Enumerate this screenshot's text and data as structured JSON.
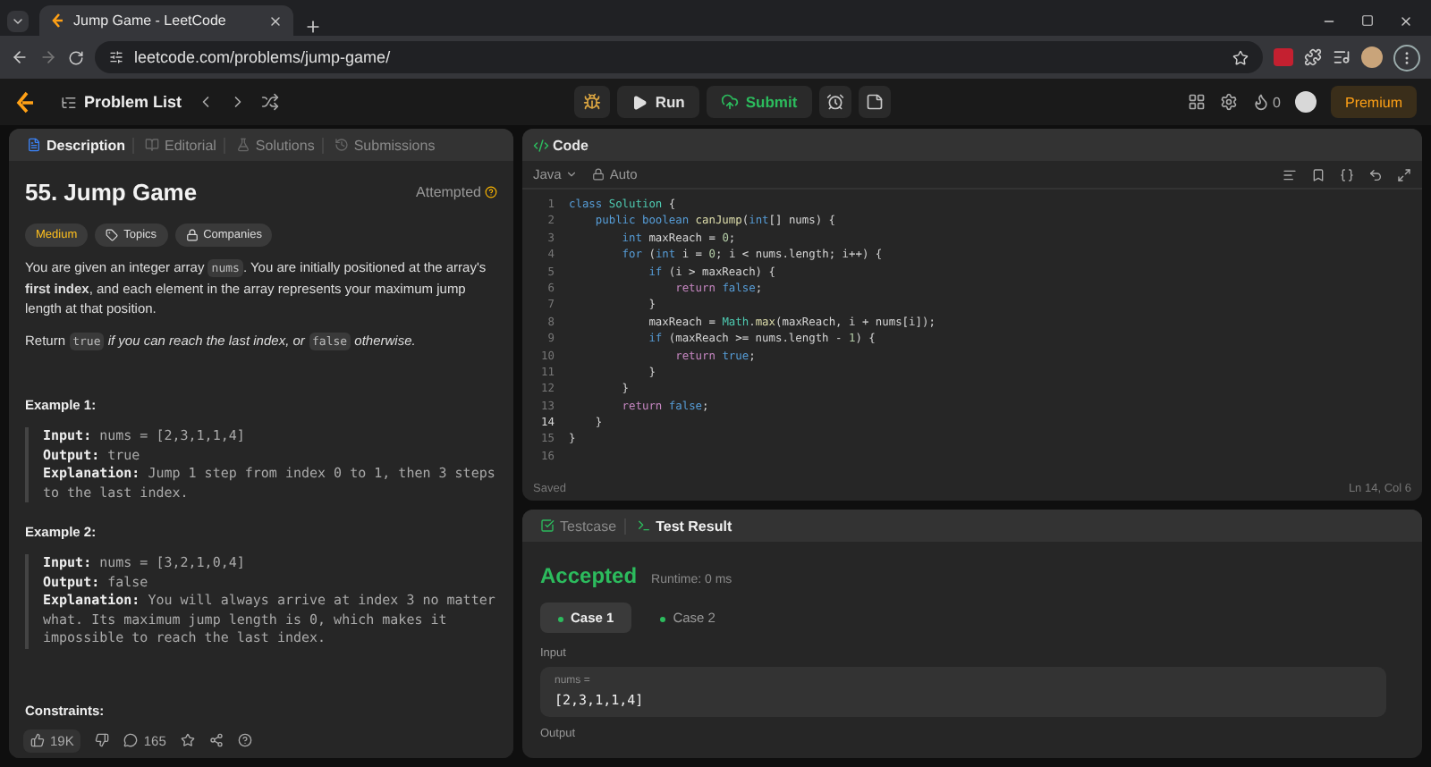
{
  "browser": {
    "tab_title": "Jump Game - LeetCode",
    "url": "leetcode.com/problems/jump-game/"
  },
  "nav": {
    "problem_list": "Problem List",
    "run": "Run",
    "submit": "Submit",
    "streak": "0",
    "premium": "Premium"
  },
  "description": {
    "tabs": [
      {
        "label": "Description",
        "selected": true
      },
      {
        "label": "Editorial",
        "selected": false
      },
      {
        "label": "Solutions",
        "selected": false
      },
      {
        "label": "Submissions",
        "selected": false
      }
    ],
    "title": "55. Jump Game",
    "status": "Attempted",
    "difficulty": "Medium",
    "chips": [
      "Topics",
      "Companies"
    ],
    "paragraphs": [
      [
        {
          "kind": "text",
          "text": "You are given an integer array "
        },
        {
          "kind": "code",
          "text": "nums"
        },
        {
          "kind": "text",
          "text": ". You are initially positioned at the array's "
        },
        {
          "kind": "bold",
          "text": "first index"
        },
        {
          "kind": "text",
          "text": ", and each element in the array represents your maximum jump length at that position."
        }
      ],
      [
        {
          "kind": "text",
          "text": "Return "
        },
        {
          "kind": "code",
          "text": "true"
        },
        {
          "kind": "italic",
          "text": " if you can reach the last index, or "
        },
        {
          "kind": "code",
          "text": "false"
        },
        {
          "kind": "italic",
          "text": " otherwise."
        }
      ]
    ],
    "examples": [
      {
        "title": "Example 1:",
        "lines": [
          {
            "label": "Input:",
            "value": "nums = [2,3,1,1,4]"
          },
          {
            "label": "Output:",
            "value": "true"
          },
          {
            "label": "Explanation:",
            "value": "Jump 1 step from index 0 to 1, then 3 steps to the last index."
          }
        ]
      },
      {
        "title": "Example 2:",
        "lines": [
          {
            "label": "Input:",
            "value": "nums = [3,2,1,0,4]"
          },
          {
            "label": "Output:",
            "value": "false"
          },
          {
            "label": "Explanation:",
            "value": "You will always arrive at index 3 no matter what. Its maximum jump length is 0, which makes it impossible to reach the last index."
          }
        ]
      }
    ],
    "constraints_title": "Constraints:",
    "likes": "19K",
    "comments": "165"
  },
  "code": {
    "title": "Code",
    "language": "Java",
    "mode": "Auto",
    "lines": [
      {
        "number": "1",
        "tokens": [
          {
            "kind": "kw",
            "text": "class "
          },
          {
            "kind": "cls",
            "text": "Solution"
          },
          {
            "kind": "plain",
            "text": " {"
          }
        ]
      },
      {
        "number": "2",
        "tokens": [
          {
            "kind": "kw",
            "text": "    public boolean "
          },
          {
            "kind": "fn",
            "text": "canJump"
          },
          {
            "kind": "plain",
            "text": "("
          },
          {
            "kind": "type",
            "text": "int"
          },
          {
            "kind": "plain",
            "text": "[] nums) {"
          }
        ]
      },
      {
        "number": "3",
        "tokens": [
          {
            "kind": "type",
            "text": "        int"
          },
          {
            "kind": "plain",
            "text": " maxReach = "
          },
          {
            "kind": "num",
            "text": "0"
          },
          {
            "kind": "plain",
            "text": ";"
          }
        ]
      },
      {
        "number": "4",
        "tokens": [
          {
            "kind": "kw",
            "text": "        for"
          },
          {
            "kind": "plain",
            "text": " ("
          },
          {
            "kind": "type",
            "text": "int"
          },
          {
            "kind": "plain",
            "text": " i = "
          },
          {
            "kind": "num",
            "text": "0"
          },
          {
            "kind": "plain",
            "text": "; i < nums.length; i++) {"
          }
        ]
      },
      {
        "number": "5",
        "tokens": [
          {
            "kind": "kw",
            "text": "            if"
          },
          {
            "kind": "plain",
            "text": " (i > maxReach) {"
          }
        ]
      },
      {
        "number": "6",
        "tokens": [
          {
            "kind": "ctl",
            "text": "                return "
          },
          {
            "kind": "lit",
            "text": "false"
          },
          {
            "kind": "plain",
            "text": ";"
          }
        ]
      },
      {
        "number": "7",
        "tokens": [
          {
            "kind": "plain",
            "text": "            }"
          }
        ]
      },
      {
        "number": "8",
        "tokens": [
          {
            "kind": "plain",
            "text": "            maxReach = "
          },
          {
            "kind": "cls",
            "text": "Math"
          },
          {
            "kind": "plain",
            "text": "."
          },
          {
            "kind": "fn",
            "text": "max"
          },
          {
            "kind": "plain",
            "text": "(maxReach, i + nums[i]);"
          }
        ]
      },
      {
        "number": "9",
        "tokens": [
          {
            "kind": "kw",
            "text": "            if"
          },
          {
            "kind": "plain",
            "text": " (maxReach >= nums.length - "
          },
          {
            "kind": "num",
            "text": "1"
          },
          {
            "kind": "plain",
            "text": ") {"
          }
        ]
      },
      {
        "number": "10",
        "tokens": [
          {
            "kind": "ctl",
            "text": "                return "
          },
          {
            "kind": "lit",
            "text": "true"
          },
          {
            "kind": "plain",
            "text": ";"
          }
        ]
      },
      {
        "number": "11",
        "tokens": [
          {
            "kind": "plain",
            "text": "            }"
          }
        ]
      },
      {
        "number": "12",
        "tokens": [
          {
            "kind": "plain",
            "text": "        }"
          }
        ]
      },
      {
        "number": "13",
        "tokens": [
          {
            "kind": "ctl",
            "text": "        return "
          },
          {
            "kind": "lit",
            "text": "false"
          },
          {
            "kind": "plain",
            "text": ";"
          }
        ]
      },
      {
        "number": "14",
        "current": true,
        "tokens": [
          {
            "kind": "plain",
            "text": "    }"
          }
        ]
      },
      {
        "number": "15",
        "tokens": [
          {
            "kind": "plain",
            "text": "}"
          }
        ]
      },
      {
        "number": "16"
      }
    ],
    "saved": "Saved",
    "cursor": "Ln 14, Col 6"
  },
  "result": {
    "tabs": [
      {
        "label": "Testcase",
        "selected": false
      },
      {
        "label": "Test Result",
        "selected": true
      }
    ],
    "verdict": "Accepted",
    "runtime": "Runtime: 0 ms",
    "cases": [
      {
        "label": "Case 1",
        "selected": true
      },
      {
        "label": "Case 2",
        "selected": false
      }
    ],
    "input_label": "Input",
    "param": "nums =",
    "value": "[2,3,1,1,4]",
    "output_label": "Output"
  }
}
